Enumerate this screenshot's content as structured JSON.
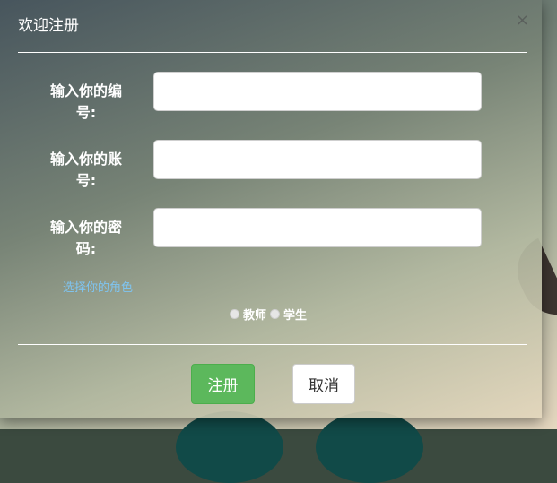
{
  "modal": {
    "title": "欢迎注册",
    "close_symbol": "×"
  },
  "form": {
    "fields": [
      {
        "label_line1": "输入你的编",
        "label_line2": "号:",
        "value": "",
        "placeholder": ""
      },
      {
        "label_line1": "输入你的账",
        "label_line2": "号:",
        "value": "",
        "placeholder": ""
      },
      {
        "label_line1": "输入你的密",
        "label_line2": "码:",
        "value": "",
        "placeholder": ""
      }
    ],
    "role_hint": "选择你的角色",
    "roles": [
      {
        "label": "教师",
        "selected": false
      },
      {
        "label": "学生",
        "selected": false
      }
    ]
  },
  "footer": {
    "register_label": "注册",
    "cancel_label": "取消"
  },
  "colors": {
    "register_button": "#5cb85c",
    "role_hint": "#7fc4f0"
  },
  "icons": {
    "close": "close-icon",
    "radio": "radio-icon"
  }
}
